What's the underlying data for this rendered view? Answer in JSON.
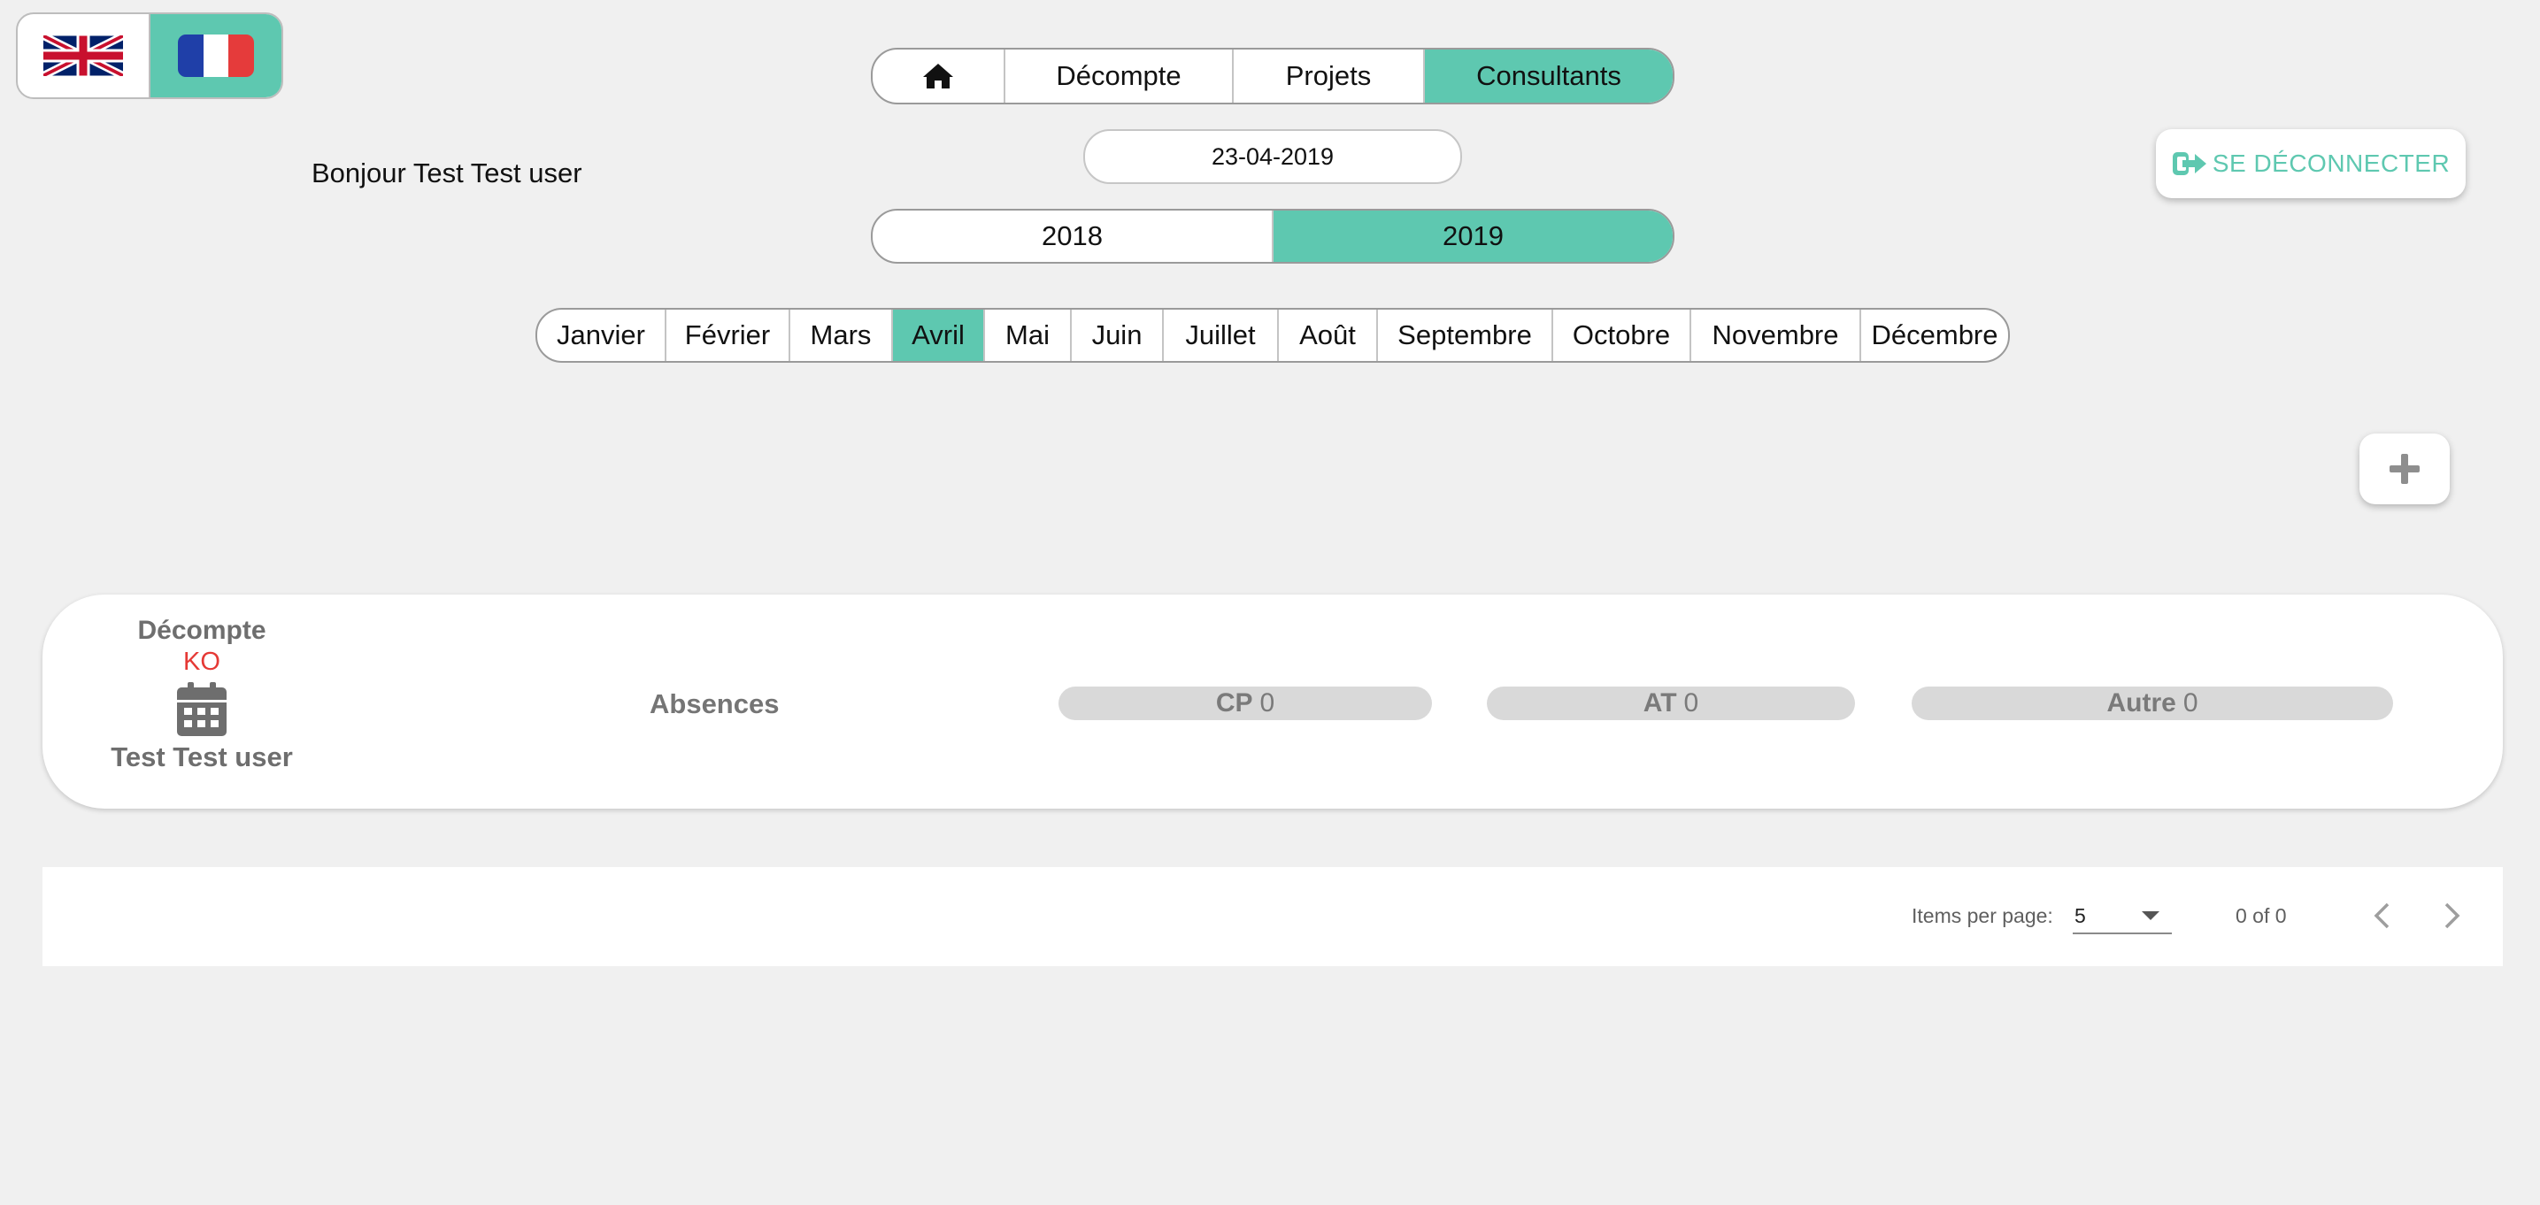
{
  "languages": [
    {
      "name": "english-flag",
      "code": "en",
      "active": false
    },
    {
      "name": "french-flag",
      "code": "fr",
      "active": true
    }
  ],
  "nav": {
    "home_icon": "home-icon",
    "tabs": [
      {
        "label": "Décompte",
        "active": false
      },
      {
        "label": "Projets",
        "active": false
      },
      {
        "label": "Consultants",
        "active": true
      }
    ]
  },
  "greeting": "Bonjour Test Test user",
  "date": "23-04-2019",
  "logout": {
    "label": "SE DÉCONNECTER",
    "icon": "sign-out-icon"
  },
  "years": [
    {
      "label": "2018",
      "active": false
    },
    {
      "label": "2019",
      "active": true
    }
  ],
  "months": [
    {
      "label": "Janvier",
      "active": false
    },
    {
      "label": "Février",
      "active": false
    },
    {
      "label": "Mars",
      "active": false
    },
    {
      "label": "Avril",
      "active": true
    },
    {
      "label": "Mai",
      "active": false
    },
    {
      "label": "Juin",
      "active": false
    },
    {
      "label": "Juillet",
      "active": false
    },
    {
      "label": "Août",
      "active": false
    },
    {
      "label": "Septembre",
      "active": false
    },
    {
      "label": "Octobre",
      "active": false
    },
    {
      "label": "Novembre",
      "active": false
    },
    {
      "label": "Décembre",
      "active": false
    }
  ],
  "add_button_icon": "plus-icon",
  "consultant": {
    "decompte_label": "Décompte",
    "status": "KO",
    "calendar_icon": "calendar-icon",
    "name": "Test Test user",
    "absences_label": "Absences",
    "counters": {
      "cp": {
        "key": "CP",
        "value": "0"
      },
      "at": {
        "key": "AT",
        "value": "0"
      },
      "other": {
        "key": "Autre",
        "value": "0"
      }
    }
  },
  "paginator": {
    "items_per_page_label": "Items per page:",
    "items_per_page": "5",
    "range": "0 of 0"
  },
  "colors": {
    "accent": "#5ec8b0",
    "background": "#f0f0f0",
    "status_ko": "#e53935"
  }
}
